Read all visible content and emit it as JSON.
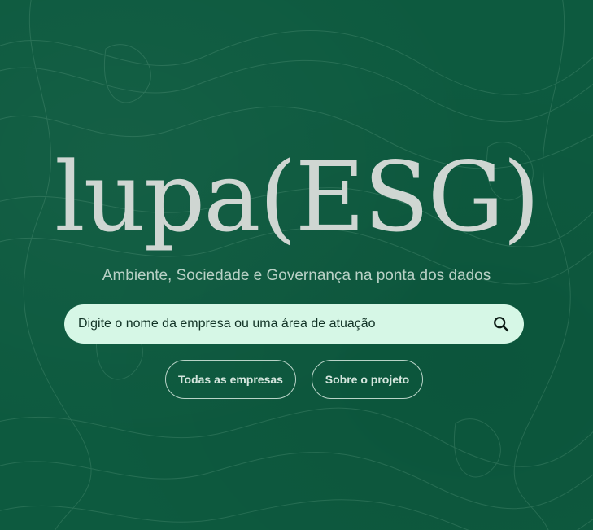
{
  "brand": {
    "logo_text": "lupa(ESG)",
    "tagline": "Ambiente, Sociedade e Governança na ponta dos dados"
  },
  "search": {
    "placeholder": "Digite o nome da empresa ou uma área de atuação",
    "icon": "search-icon"
  },
  "actions": {
    "all_companies_label": "Todas as empresas",
    "about_label": "Sobre o projeto"
  },
  "colors": {
    "background": "#0d5a3f",
    "logo": "#cfd6d2",
    "search_bg": "#d6f7e6",
    "button_border": "#b8d3c7"
  }
}
